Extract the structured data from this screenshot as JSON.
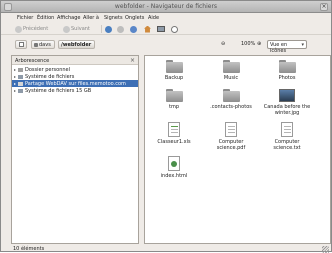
{
  "window": {
    "title": "webfolder - Navigateur de fichiers",
    "close_label": "×"
  },
  "menu": [
    "Fichier",
    "Édition",
    "Affichage",
    "Aller à",
    "Signets",
    "Onglets",
    "Aide"
  ],
  "toolbar": {
    "back": "Précédent",
    "forward": "Suivant"
  },
  "location": {
    "crumbs": [
      "davs",
      "/webfolder"
    ],
    "zoom": "100%",
    "view": "Vue en icônes"
  },
  "sidebar": {
    "header": "Arborescence",
    "items": [
      {
        "label": "Dossier personnel",
        "expander": "▸"
      },
      {
        "label": "Système de fichiers",
        "expander": "▸"
      },
      {
        "label": "Partage WebDAV sur files.memotoo.com",
        "expander": "▸"
      },
      {
        "label": "Système de fichiers 15 GB",
        "expander": "▸"
      }
    ]
  },
  "files": [
    {
      "name": "Backup",
      "type": "folder"
    },
    {
      "name": "Music",
      "type": "folder"
    },
    {
      "name": "Photos",
      "type": "folder"
    },
    {
      "name": "tmp",
      "type": "folder"
    },
    {
      "name": ".contacts-photos",
      "type": "folder"
    },
    {
      "name": "Canada before the winter.jpg",
      "type": "image"
    },
    {
      "name": "Classeur1.xls",
      "type": "spreadsheet"
    },
    {
      "name": "Computer science.pdf",
      "type": "pdf"
    },
    {
      "name": "Computer science.txt",
      "type": "text"
    },
    {
      "name": "index.html",
      "type": "html"
    }
  ],
  "status": {
    "text": "10 éléments"
  },
  "colors": {
    "selection": "#3d6fb5",
    "window_bg": "#efebe7"
  }
}
